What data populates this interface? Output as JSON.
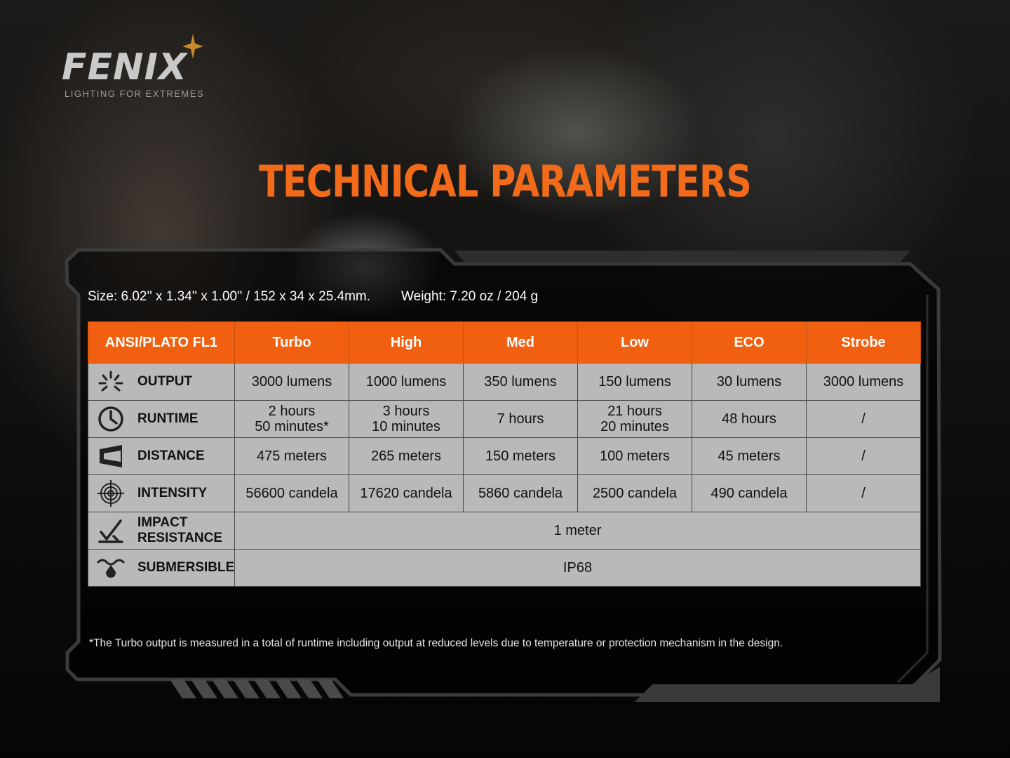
{
  "logo": {
    "brand": "FENIX",
    "tagline": "LIGHTING FOR EXTREMES"
  },
  "title": "TECHNICAL PARAMETERS",
  "specs": {
    "size": "Size: 6.02'' x 1.34'' x 1.00'' / 152 x 34 x 25.4mm.",
    "weight": "Weight: 7.20 oz / 204 g"
  },
  "table": {
    "headers": [
      "ANSI/PLATO FL1",
      "Turbo",
      "High",
      "Med",
      "Low",
      "ECO",
      "Strobe"
    ],
    "rows": {
      "output": {
        "icon": "burst-icon",
        "label": "OUTPUT",
        "values": [
          "3000 lumens",
          "1000 lumens",
          "350 lumens",
          "150 lumens",
          "30 lumens",
          "3000 lumens"
        ]
      },
      "runtime": {
        "icon": "clock-icon",
        "label": "RUNTIME",
        "values": [
          [
            "2 hours",
            "50 minutes*"
          ],
          [
            "3 hours",
            "10 minutes"
          ],
          [
            "7 hours"
          ],
          [
            "21 hours",
            "20 minutes"
          ],
          [
            "48 hours"
          ],
          [
            "/"
          ]
        ]
      },
      "distance": {
        "icon": "beam-icon",
        "label": "DISTANCE",
        "values": [
          "475 meters",
          "265 meters",
          "150 meters",
          "100 meters",
          "45 meters",
          "/"
        ]
      },
      "intensity": {
        "icon": "target-icon",
        "label": "INTENSITY",
        "values": [
          "56600 candela",
          "17620 candela",
          "5860 candela",
          "2500 candela",
          "490 candela",
          "/"
        ]
      },
      "impact": {
        "icon": "impact-icon",
        "label_lines": [
          "IMPACT",
          "RESISTANCE"
        ],
        "value": "1 meter"
      },
      "submersible": {
        "icon": "water-drop-icon",
        "label": "SUBMERSIBLE",
        "value": "IP68"
      }
    }
  },
  "footnote": "*The Turbo output is measured in a total of runtime including output at reduced levels due to temperature or protection mechanism in the design.",
  "colors": {
    "accent": "#f06010",
    "title": "#f26b1a",
    "cell": "#b9b9b9",
    "background": "#0a0a0a"
  }
}
